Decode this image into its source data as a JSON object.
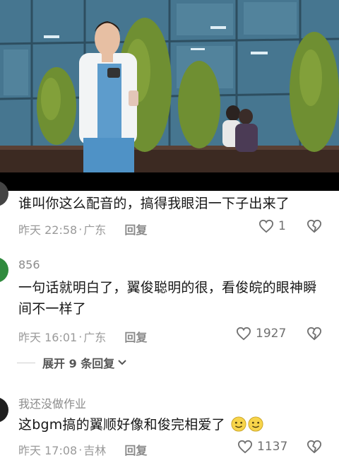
{
  "video": {
    "description_icon": "video-frame"
  },
  "comments": [
    {
      "username": "",
      "text": "谁叫你这么配音的，搞得我眼泪一下子出来了",
      "time": "昨天 22:58",
      "location": "广东",
      "reply_label": "回复",
      "likes": "1",
      "liked": false
    },
    {
      "username": "856",
      "text": "一句话就明白了，翼俊聪明的很，看俊皖的眼神瞬间不一样了",
      "time": "昨天 16:01",
      "location": "广东",
      "reply_label": "回复",
      "likes": "1927",
      "liked": false,
      "expand_label": "展开 9 条回复"
    },
    {
      "username": "我还没做作业",
      "text": "这bgm搞的翼顺好像和俊完相爱了",
      "time": "昨天 17:08",
      "location": "吉林",
      "reply_label": "回复",
      "likes": "1137",
      "liked": false
    }
  ],
  "separator": "·",
  "colors": {
    "meta": "#9a9a9a",
    "text": "#161616",
    "icon": "#707070"
  }
}
